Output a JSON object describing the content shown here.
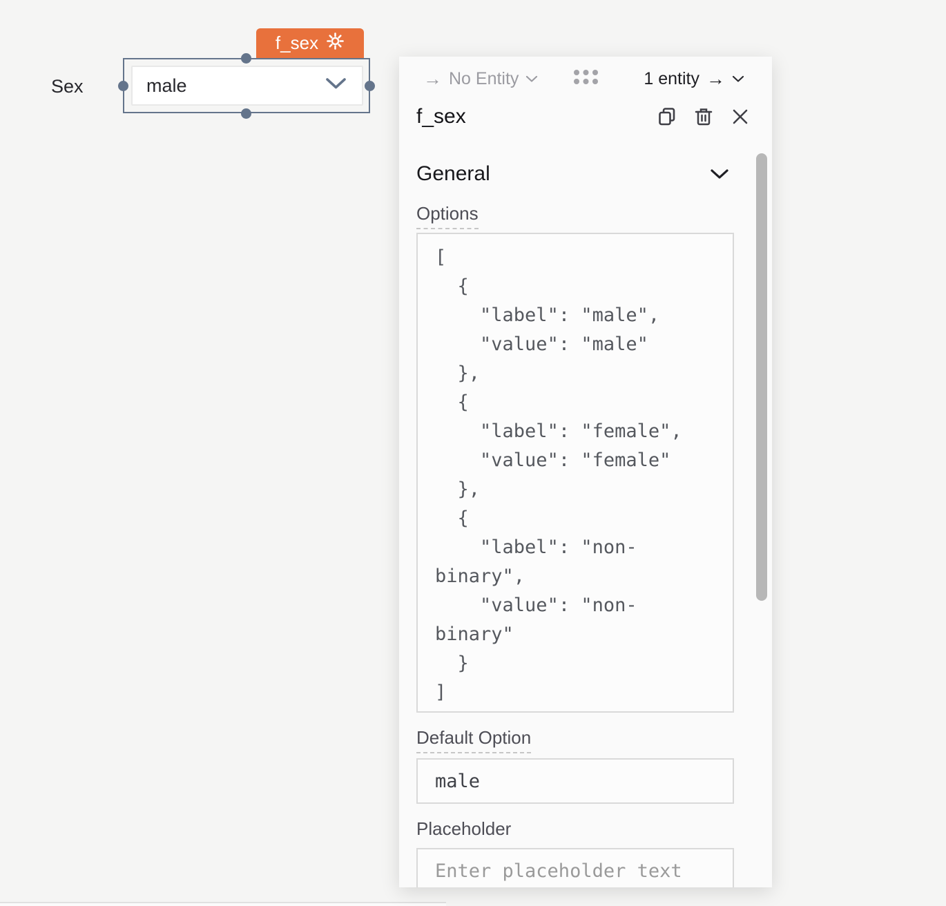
{
  "canvas": {
    "field_label": "Sex",
    "selected_value": "male",
    "component_tag": "f_sex"
  },
  "panel": {
    "entity_left": "No Entity",
    "entity_right": "1 entity",
    "arrow_glyph": "→",
    "title": "f_sex",
    "general_section_label": "General",
    "options_label": "Options",
    "options_json": "[\n  {\n    \"label\": \"male\",\n    \"value\": \"male\"\n  },\n  {\n    \"label\": \"female\",\n    \"value\": \"female\"\n  },\n  {\n    \"label\": \"non-binary\",\n    \"value\": \"non-binary\"\n  }\n]",
    "default_option_label": "Default Option",
    "default_option_value": "male",
    "placeholder_label": "Placeholder",
    "placeholder_text": "Enter placeholder text"
  },
  "colors": {
    "accent_orange": "#e8713c",
    "selection_slate": "#64748b",
    "page_bg": "#f5f5f4",
    "panel_bg": "#fafafa",
    "scrollbar": "#b7b7b7"
  },
  "icons": {
    "tag_icon": "gear-icon",
    "title_actions": [
      "duplicate-icon",
      "trash-icon",
      "close-icon"
    ],
    "header_center": "grid-dots-icon"
  }
}
